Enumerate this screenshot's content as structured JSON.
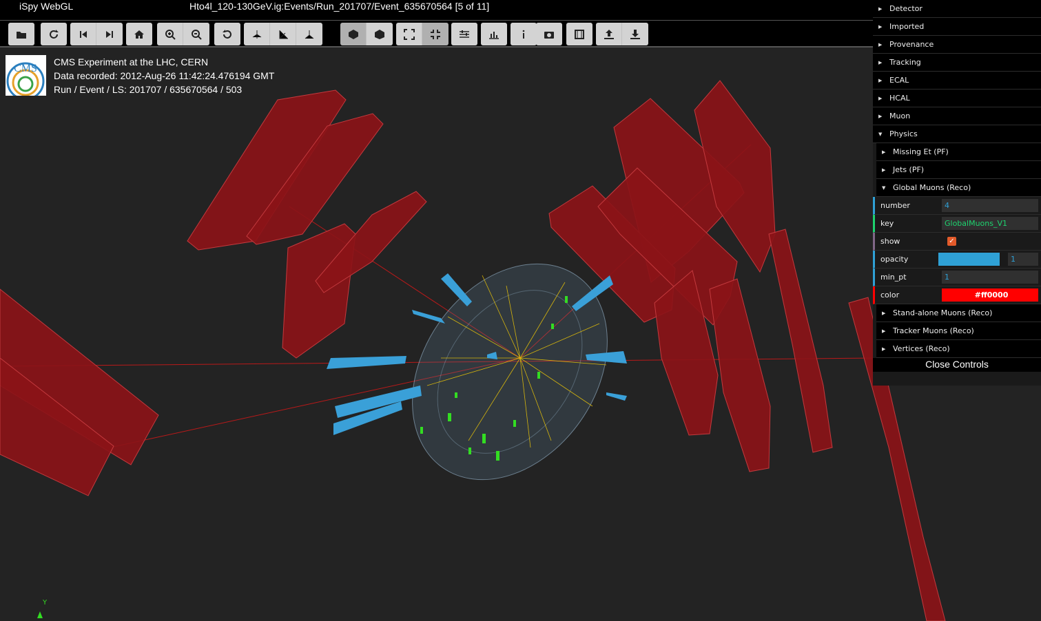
{
  "titlebar": {
    "app_title": "iSpy WebGL",
    "event_title": "Hto4l_120-130GeV.ig:Events/Run_201707/Event_635670564 [5 of 11]"
  },
  "toolbar": {
    "buttons": [
      {
        "name": "open-file-button",
        "icon": "folder-open-icon"
      },
      {
        "name": "reload-button",
        "icon": "redo-icon"
      },
      {
        "name": "previous-event-button",
        "icon": "step-backward-icon"
      },
      {
        "name": "next-event-button",
        "icon": "step-forward-icon"
      },
      {
        "name": "home-view-button",
        "icon": "home-icon"
      },
      {
        "name": "zoom-in-button",
        "icon": "zoom-in-icon"
      },
      {
        "name": "zoom-out-button",
        "icon": "zoom-out-icon"
      },
      {
        "name": "reset-view-button",
        "icon": "undo-icon"
      },
      {
        "name": "view-yz-button",
        "icon": "axes-yz-icon"
      },
      {
        "name": "view-xz-button",
        "icon": "axes-xz-icon"
      },
      {
        "name": "view-xy-button",
        "icon": "axes-xy-icon"
      },
      {
        "name": "perspective-button",
        "icon": "cube-perspective-icon"
      },
      {
        "name": "orthographic-button",
        "icon": "cube-ortho-icon"
      },
      {
        "name": "fullscreen-button",
        "icon": "expand-icon"
      },
      {
        "name": "exit-fullscreen-button",
        "icon": "compress-icon"
      },
      {
        "name": "settings-button",
        "icon": "sliders-icon"
      },
      {
        "name": "table-view-button",
        "icon": "bar-chart-icon"
      },
      {
        "name": "info-button",
        "icon": "info-icon"
      },
      {
        "name": "screenshot-button",
        "icon": "camera-icon"
      },
      {
        "name": "animation-button",
        "icon": "film-icon"
      },
      {
        "name": "export-button",
        "icon": "upload-icon"
      },
      {
        "name": "import-button",
        "icon": "download-icon"
      }
    ]
  },
  "event_info": {
    "line1": "CMS Experiment at the LHC, CERN",
    "line2": "Data recorded: 2012-Aug-26 11:42:24.476194 GMT",
    "line3": "Run / Event / LS: 201707 / 635670564 / 503",
    "logo_text": "CMS"
  },
  "controls": {
    "folders": [
      "Detector",
      "Imported",
      "Provenance",
      "Tracking",
      "ECAL",
      "HCAL",
      "Muon",
      "Physics"
    ],
    "physics_items": [
      "Missing Et (PF)",
      "Jets (PF)",
      "Global Muons (Reco)"
    ],
    "global_muons": {
      "number_label": "number",
      "number_value": "4",
      "key_label": "key",
      "key_value": "GlobalMuons_V1",
      "show_label": "show",
      "opacity_label": "opacity",
      "opacity_value": "1",
      "min_pt_label": "min_pt",
      "min_pt_value": "1",
      "color_label": "color",
      "color_value": "#ff0000"
    },
    "after_items": [
      "Stand-alone Muons (Reco)",
      "Tracker Muons (Reco)",
      "Vertices (Reco)"
    ],
    "close_label": "Close Controls"
  },
  "axis": {
    "y_label": "Y"
  },
  "colors": {
    "muon_chamber": "#8b1418",
    "muon_track": "#ff0000",
    "calo": "#3aa0d8",
    "tracks": "#ffd400",
    "hits": "#33dd22"
  }
}
